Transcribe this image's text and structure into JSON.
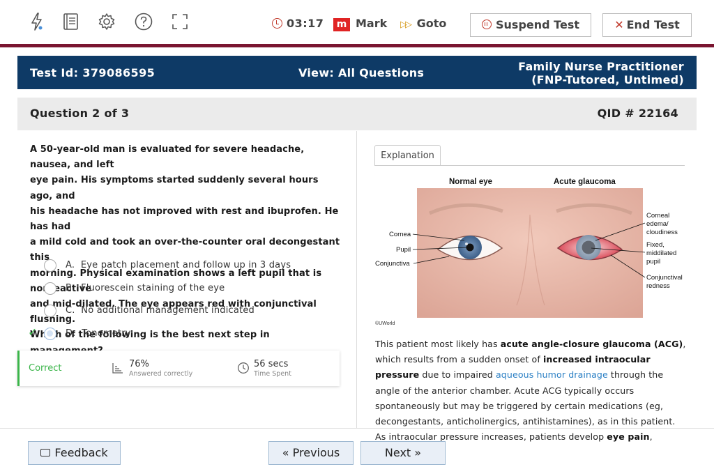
{
  "toolbar": {
    "icons": [
      "lightning-icon",
      "notebook-icon",
      "gear-icon",
      "help-icon",
      "fullscreen-icon"
    ],
    "timer": "03:17",
    "mark_badge": "m",
    "mark_label": "Mark",
    "goto_label": "Goto",
    "suspend_label": "Suspend Test",
    "end_label": "End Test"
  },
  "header": {
    "test_id": "Test Id: 379086595",
    "view": "View: All Questions",
    "course_line1": "Family Nurse Practitioner",
    "course_line2": "(FNP-Tutored, Untimed)"
  },
  "question_bar": {
    "number": "Question 2 of 3",
    "qid": "QID # 22164"
  },
  "question": {
    "stem_lines": [
      "A 50-year-old man is evaluated for severe headache, nausea, and left",
      "eye pain.  His symptoms started suddenly several hours ago, and",
      "his headache has not improved with rest and ibuprofen.  He has had",
      "a mild cold and took an over-the-counter oral decongestant this",
      "morning.  Physical examination shows a left pupil that is nonreactive",
      "and mid-dilated.  The eye appears red with conjunctival flushing.",
      "Which of the following is the best next step in management?"
    ],
    "options": [
      {
        "letter": "A.",
        "text": "Eye patch placement and follow up in 3 days"
      },
      {
        "letter": "B.",
        "text": "Fluorescein staining of the eye"
      },
      {
        "letter": "C.",
        "text": "No additional management indicated"
      },
      {
        "letter": "D.",
        "text": "Tonometry"
      }
    ],
    "selected": "D",
    "correct": "D"
  },
  "stats": {
    "result": "Correct",
    "percent": "76%",
    "percent_label": "Answered correctly",
    "time": "56 secs",
    "time_label": "Time Spent"
  },
  "explanation": {
    "tab_label": "Explanation",
    "figure": {
      "title_left": "Normal eye",
      "title_right": "Acute glaucoma",
      "labels_left": [
        "Cornea",
        "Pupil",
        "Conjunctiva"
      ],
      "labels_right": [
        "Corneal",
        "edema/",
        "cloudiness",
        "Fixed,",
        "middilated",
        "pupil",
        "Conjunctival",
        "redness"
      ],
      "credit": "©UWorld"
    },
    "p1_a": "This patient most likely has ",
    "p1_b": "acute angle-closure glaucoma (ACG)",
    "p1_c": ", which results from a sudden onset of ",
    "p1_d": "increased intraocular pressure",
    "p1_e": " due to impaired ",
    "p1_link": "aqueous humor drainage",
    "p1_f": " through the angle of the anterior chamber. Acute ACG typically occurs spontaneously but may be triggered by certain medications (eg, decongestants, anticholinergics, antihistamines), as in this patient.  As intraocular pressure increases, patients develop ",
    "p1_g": "eye pain",
    "p1_h": ","
  },
  "footer": {
    "feedback_label": "Feedback",
    "previous_label": "Previous",
    "next_label": "Next"
  }
}
